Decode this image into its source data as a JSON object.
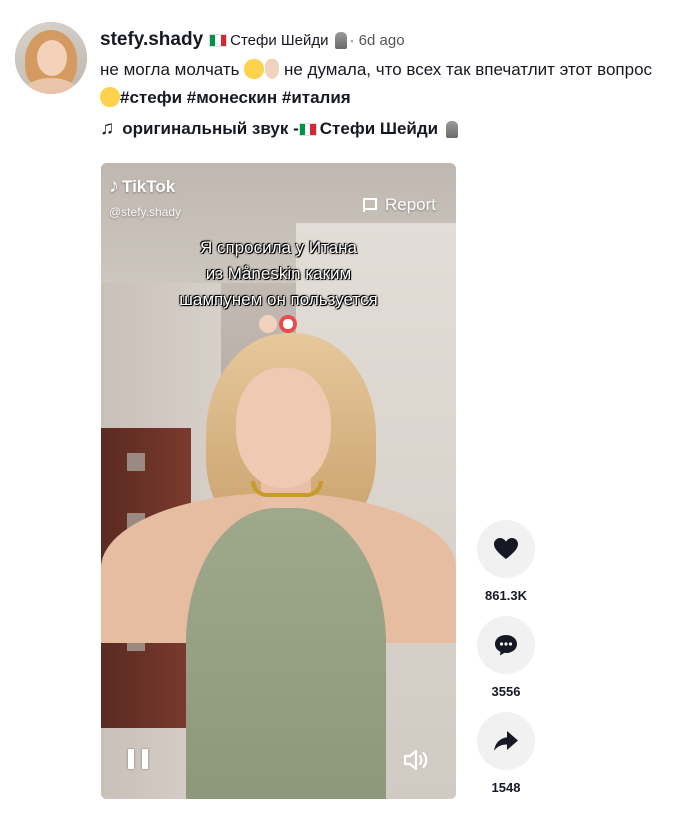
{
  "post": {
    "username": "stefy.shady",
    "nickname": "Стефи Шейди",
    "time_ago": "· 6d ago",
    "description_parts": {
      "a": "не могла молчать ",
      "b": " не думала, что всех так впечатлит этот вопрос ",
      "tag1": "#стефи",
      "tag2": "#монескин",
      "tag3": "#италия"
    },
    "music": {
      "prefix": "оригинальный звук - ",
      "artist": "Стефи Шейди"
    }
  },
  "video": {
    "logo_text": "TikTok",
    "handle": "@stefy.shady",
    "report_label": "Report",
    "caption": {
      "line1": "Я спросила у Итана",
      "line2": "из Måneskin каким",
      "line3": "шампунем он пользуется"
    }
  },
  "actions": {
    "likes": "861.3K",
    "comments": "3556",
    "shares": "1548"
  },
  "colors": {
    "text": "#161823",
    "action_bg": "#f1f1f2",
    "flag_green": "#009246",
    "flag_white": "#ffffff",
    "flag_red": "#ce2b37"
  },
  "icons": [
    "music-note-icon",
    "flag-icon",
    "pause-icon",
    "volume-icon",
    "heart-icon",
    "comment-icon",
    "share-icon",
    "tiktok-logo-icon"
  ]
}
